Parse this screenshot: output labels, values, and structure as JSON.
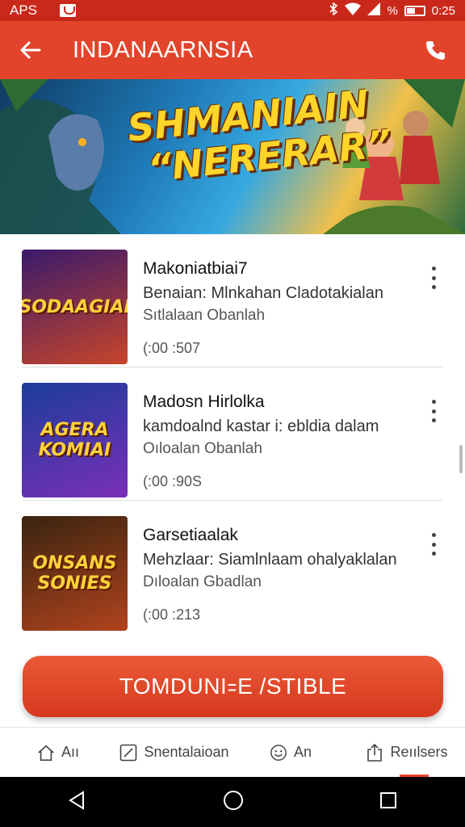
{
  "status_bar": {
    "left_text": "APS",
    "time": "0:25",
    "percent": "%"
  },
  "app_bar": {
    "title": "INDANAARNSIA"
  },
  "banner": {
    "line1": "SHMANIAIN",
    "line2": "“NERERAR”"
  },
  "items": [
    {
      "thumb_text": "SODAAGIAI",
      "title": "Makoniatbiai7",
      "subtitle": "Benaian: Mlnkahan Cladotakialan",
      "secondary": "Sıtlalaan Obanlah",
      "time": "(:00 :507",
      "thumb_colors": [
        "#3a1a6b",
        "#c7452a"
      ]
    },
    {
      "thumb_text": "AGERA KOMIAI",
      "title": "Madosn Hirlolka",
      "subtitle": "kamdoalnd kastar i: ebldia dalam",
      "secondary": "Oıloalan Obanlah",
      "time": "(:00 :90S",
      "thumb_colors": [
        "#1b3d9a",
        "#7a2fb8"
      ]
    },
    {
      "thumb_text": "ONSANS SONIES",
      "title": "Garsetiaalak",
      "subtitle": "Mehzlaar: Siamlnlaam ohalyaklalan",
      "secondary": "Dıloalan Gbadlan",
      "time": "(:00 :213",
      "thumb_colors": [
        "#3a2410",
        "#b0431d"
      ]
    }
  ],
  "cta": {
    "label": "TOMDUNI꞊E /STIBLE"
  },
  "bottom_nav": [
    {
      "label": "Aıı",
      "icon": "home-icon"
    },
    {
      "label": "Snentalaioan",
      "icon": "edit-icon"
    },
    {
      "label": "An",
      "icon": "emoji-icon"
    },
    {
      "label": "Reıılsers",
      "icon": "share-icon"
    }
  ],
  "colors": {
    "primary": "#e2442b",
    "status_bar": "#c9281a"
  }
}
